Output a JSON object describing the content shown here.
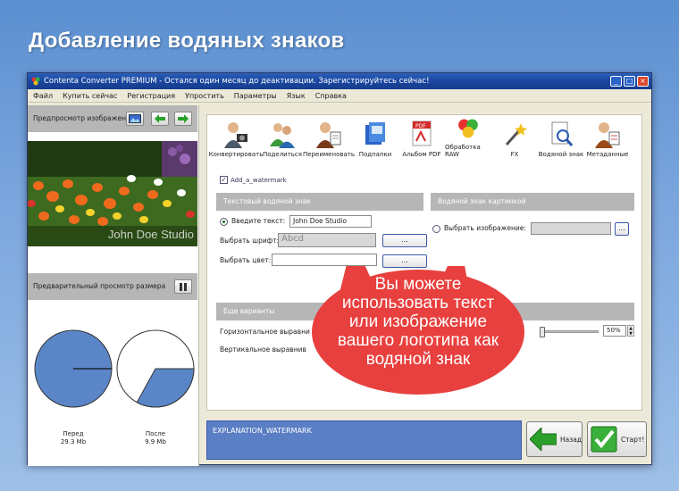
{
  "promo_title": "Добавление водяных знаков",
  "window": {
    "title": "Contenta Converter PREMIUM - Остался один месяц до деактивации. Зарегистрируйтесь сейчас!",
    "controls": [
      "_",
      "□",
      "×"
    ]
  },
  "menu": [
    "Файл",
    "Купить сейчас",
    "Регистрация",
    "Упростить",
    "Параметры",
    "Язык",
    "Справка"
  ],
  "left_panel": {
    "preview_header": "Предпросмотр изображения",
    "watermark_overlay": "John Doe Studio",
    "size_header": "Предварительный просмотр размера",
    "before": {
      "label": "Перед",
      "size": "29.3 Mb",
      "fraction": 1.0
    },
    "after": {
      "label": "После",
      "size": "9.9 Mb",
      "fraction": 0.33
    }
  },
  "toolbar": [
    "Конвертировать",
    "Поделиться",
    "Переименовать",
    "Подпапки",
    "Альбом PDF",
    "Обработка RAW",
    "FX",
    "Водяной знак",
    "Метаданные"
  ],
  "watermark": {
    "checkbox_label": "Add_a_watermark",
    "text_group": "Текстовый водяной знак",
    "image_group": "Водяной знак картинкой",
    "enter_text_label": "Введите текст:",
    "text_value": "John Doe Studio",
    "font_label": "Выбрать шрифт:",
    "font_value": "Abcd",
    "color_label": "Выбрать цвет:",
    "dots": "...",
    "image_label": "Выбрать изображение:",
    "more_group": "Еще варианты",
    "h_align_label": "Горизонтальное выравни",
    "v_align_label": "Вертикальное выравнив",
    "opacity_value": "50%",
    "opacity_fraction": 0.5
  },
  "explanation": "EXPLANATION_WATERMARK",
  "back_button": "Назад",
  "start_button": "Старт!",
  "callout_lines": [
    "Вы можете",
    "использовать текст",
    "или изображение",
    "вашего логотипа как",
    "водяной знак"
  ],
  "colors": {
    "accent_blue": "#1a47a0",
    "callout_red": "#e8403e",
    "bar_gray": "#b6b6b6"
  }
}
